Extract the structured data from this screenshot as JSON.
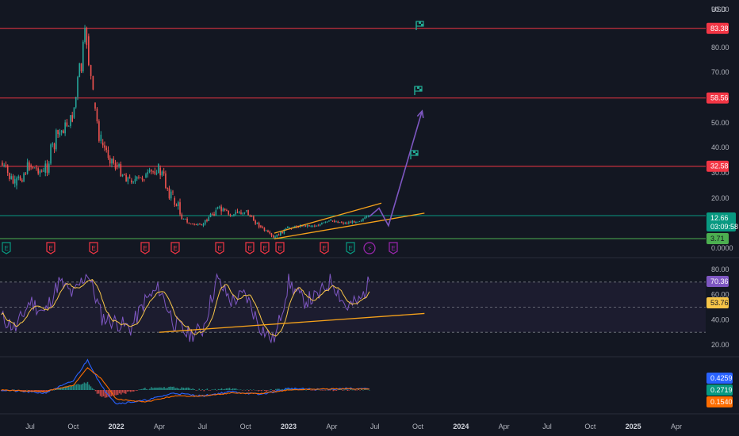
{
  "currency": "USD",
  "colors": {
    "background": "#131722",
    "up": "#26a69a",
    "down": "#ef5350",
    "resistance": "#f23645",
    "support_green": "#4caf50",
    "support_teal": "#089981",
    "channel": "#f7a21b",
    "forecast": "#7e57c2",
    "rsi": "#7e57c2",
    "rsi_ma": "#f7c548",
    "macd": "#2962ff",
    "signal": "#ff6d00",
    "flag": "#22ab94",
    "event_red": "#f23645",
    "event_green": "#089981",
    "event_purple": "#9c27b0"
  },
  "price_axis": {
    "ticks": [
      "90.00",
      "80.00",
      "70.00",
      "60.00",
      "50.00",
      "40.00",
      "30.00",
      "20.00",
      "0.0000"
    ]
  },
  "price_levels": [
    {
      "label": "83.38",
      "type": "resistance"
    },
    {
      "label": "58.56",
      "type": "resistance"
    },
    {
      "label": "32.58",
      "type": "resistance"
    },
    {
      "label": "3.71",
      "type": "support"
    }
  ],
  "last_price": {
    "label": "12.66",
    "countdown": "03:09:58"
  },
  "rsi_pane": {
    "ticks": [
      "80.00",
      "60.00",
      "40.00",
      "20.00"
    ],
    "rsi_label": "70.36",
    "ma_label": "53.76"
  },
  "macd_pane": {
    "labels": [
      {
        "text": "0.4259",
        "kind": "macd"
      },
      {
        "text": "0.2719",
        "kind": "histogram"
      },
      {
        "text": "0.1540",
        "kind": "signal"
      }
    ]
  },
  "time_axis": [
    {
      "label": "Jul",
      "bold": false
    },
    {
      "label": "Oct",
      "bold": false
    },
    {
      "label": "2022",
      "bold": true
    },
    {
      "label": "Apr",
      "bold": false
    },
    {
      "label": "Jul",
      "bold": false
    },
    {
      "label": "Oct",
      "bold": false
    },
    {
      "label": "2023",
      "bold": true
    },
    {
      "label": "Apr",
      "bold": false
    },
    {
      "label": "Jul",
      "bold": false
    },
    {
      "label": "Oct",
      "bold": false
    },
    {
      "label": "2024",
      "bold": true
    },
    {
      "label": "Apr",
      "bold": false
    },
    {
      "label": "Jul",
      "bold": false
    },
    {
      "label": "Oct",
      "bold": false
    },
    {
      "label": "2025",
      "bold": true
    },
    {
      "label": "Apr",
      "bold": false
    }
  ],
  "event_markers": [
    {
      "letter": "E",
      "kind": "green"
    },
    {
      "letter": "E",
      "kind": "red"
    },
    {
      "letter": "E",
      "kind": "red"
    },
    {
      "letter": "E",
      "kind": "red"
    },
    {
      "letter": "E",
      "kind": "red"
    },
    {
      "letter": "E",
      "kind": "red"
    },
    {
      "letter": "E",
      "kind": "red"
    },
    {
      "letter": "E",
      "kind": "red"
    },
    {
      "letter": "E",
      "kind": "red"
    },
    {
      "letter": "E",
      "kind": "red"
    },
    {
      "letter": "E",
      "kind": "green"
    },
    {
      "letter": "⚡",
      "kind": "purple"
    },
    {
      "letter": "E",
      "kind": "purple"
    }
  ],
  "chart_data": {
    "type": "line",
    "title": "",
    "ylabel": "USD",
    "ylim": [
      0,
      90
    ],
    "x_start": "2021-05",
    "x_end": "2025-05",
    "series": [
      {
        "kind": "price",
        "points": [
          [
            "2021-05",
            34
          ],
          [
            "2021-06",
            25
          ],
          [
            "2021-07",
            33
          ],
          [
            "2021-08",
            30
          ],
          [
            "2021-09",
            45
          ],
          [
            "2021-10",
            52
          ],
          [
            "2021-11-01",
            83
          ],
          [
            "2021-11-15",
            58
          ],
          [
            "2021-12",
            42
          ],
          [
            "2022-01",
            33
          ],
          [
            "2022-02",
            27
          ],
          [
            "2022-03",
            28
          ],
          [
            "2022-04",
            32
          ],
          [
            "2022-05",
            20
          ],
          [
            "2022-06",
            10
          ],
          [
            "2022-07",
            9
          ],
          [
            "2022-08",
            16
          ],
          [
            "2022-09",
            13
          ],
          [
            "2022-10",
            15
          ],
          [
            "2022-11",
            9
          ],
          [
            "2022-12",
            4
          ],
          [
            "2023-01",
            8
          ],
          [
            "2023-02",
            9
          ],
          [
            "2023-03",
            9
          ],
          [
            "2023-04",
            11
          ],
          [
            "2023-05",
            10
          ],
          [
            "2023-06",
            11
          ],
          [
            "2023-06-20",
            12.66
          ]
        ]
      },
      {
        "kind": "forecast",
        "points": [
          [
            "2023-06-20",
            12.66
          ],
          [
            "2023-07-10",
            16
          ],
          [
            "2023-07-30",
            9
          ],
          [
            "2023-10-10",
            58
          ]
        ]
      },
      {
        "kind": "channel_upper",
        "points": [
          [
            "2022-12-01",
            6
          ],
          [
            "2023-07-15",
            18
          ]
        ]
      },
      {
        "kind": "channel_lower",
        "points": [
          [
            "2022-12-01",
            3.71
          ],
          [
            "2023-10-15",
            14
          ]
        ]
      }
    ],
    "rsi": {
      "ylim": [
        20,
        80
      ],
      "band": [
        30,
        70
      ],
      "points": [
        [
          "2021-05",
          42
        ],
        [
          "2021-06",
          33
        ],
        [
          "2021-07",
          55
        ],
        [
          "2021-08",
          45
        ],
        [
          "2021-09",
          70
        ],
        [
          "2021-10",
          60
        ],
        [
          "2021-11",
          78
        ],
        [
          "2021-12",
          42
        ],
        [
          "2022-01",
          38
        ],
        [
          "2022-02",
          33
        ],
        [
          "2022-03",
          55
        ],
        [
          "2022-04",
          65
        ],
        [
          "2022-05",
          38
        ],
        [
          "2022-06",
          28
        ],
        [
          "2022-07",
          32
        ],
        [
          "2022-08",
          72
        ],
        [
          "2022-09",
          55
        ],
        [
          "2022-10",
          60
        ],
        [
          "2022-11",
          35
        ],
        [
          "2022-12",
          22
        ],
        [
          "2023-01",
          70
        ],
        [
          "2023-02",
          55
        ],
        [
          "2023-03",
          58
        ],
        [
          "2023-04",
          72
        ],
        [
          "2023-05",
          50
        ],
        [
          "2023-06",
          55
        ],
        [
          "2023-06-20",
          70.36
        ]
      ],
      "trendline": [
        [
          "2022-04-01",
          30
        ],
        [
          "2023-10-15",
          45
        ]
      ]
    },
    "macd": {
      "ylim": [
        -0.6,
        1.2
      ],
      "macd": [
        [
          "2021-05",
          0.0
        ],
        [
          "2021-08",
          -0.1
        ],
        [
          "2021-10",
          0.3
        ],
        [
          "2021-11",
          1.0
        ],
        [
          "2021-12",
          0.1
        ],
        [
          "2022-01",
          -0.45
        ],
        [
          "2022-03",
          -0.35
        ],
        [
          "2022-05",
          -0.1
        ],
        [
          "2022-07",
          -0.2
        ],
        [
          "2022-09",
          -0.05
        ],
        [
          "2022-11",
          -0.15
        ],
        [
          "2023-01",
          0.05
        ],
        [
          "2023-03",
          0.02
        ],
        [
          "2023-05",
          0.05
        ],
        [
          "2023-06-20",
          0.03
        ]
      ],
      "signal": [
        [
          "2021-05",
          0.0
        ],
        [
          "2021-08",
          -0.05
        ],
        [
          "2021-10",
          0.15
        ],
        [
          "2021-11",
          0.75
        ],
        [
          "2021-12",
          0.35
        ],
        [
          "2022-01",
          -0.3
        ],
        [
          "2022-03",
          -0.4
        ],
        [
          "2022-05",
          -0.2
        ],
        [
          "2022-07",
          -0.2
        ],
        [
          "2022-09",
          -0.1
        ],
        [
          "2022-11",
          -0.12
        ],
        [
          "2023-01",
          0.0
        ],
        [
          "2023-03",
          0.03
        ],
        [
          "2023-05",
          0.04
        ],
        [
          "2023-06-20",
          0.03
        ]
      ]
    }
  }
}
